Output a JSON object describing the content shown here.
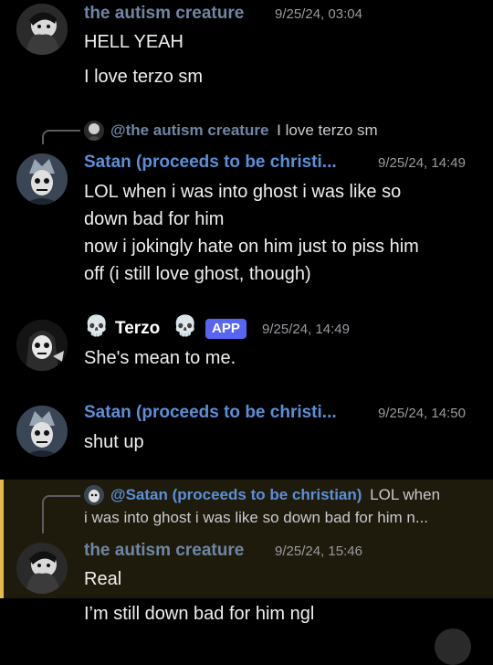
{
  "colors": {
    "background": "#000000",
    "username_autism": "#6e86a4",
    "username_satan": "#5b8fd8",
    "username_terzo": "#ffffff",
    "app_badge": "#5865f2",
    "highlight_bg": "#1f1b0c",
    "highlight_bar": "#e7b94a"
  },
  "messages": [
    {
      "username": "the autism creature",
      "timestamp": "9/25/24, 03:04",
      "lines": [
        "HELL YEAH",
        "I love terzo sm"
      ]
    },
    {
      "reply": {
        "mention": "@the autism creature",
        "text": "I love terzo sm"
      },
      "username": "Satan (proceeds to be christi...",
      "timestamp": "9/25/24, 14:49",
      "lines": [
        "LOL when i was into ghost i was like so",
        "down bad for him",
        "now i jokingly hate on him just to piss him",
        "off (i still love ghost, though)"
      ]
    },
    {
      "username": "Terzo",
      "prefix_emoji": "💀",
      "suffix_emoji": "💀",
      "badge": "APP",
      "timestamp": "9/25/24, 14:49",
      "lines": [
        "She's mean to me."
      ]
    },
    {
      "username": "Satan (proceeds to be christi...",
      "timestamp": "9/25/24, 14:50",
      "lines": [
        "shut up"
      ]
    },
    {
      "reply": {
        "mention": "@Satan (proceeds to be christian)",
        "text_line1": "LOL when",
        "text_line2": "i was into ghost i was like so down bad for him n..."
      },
      "username": "the autism creature",
      "timestamp": "9/25/24, 15:46",
      "lines": [
        "Real",
        "I’m still down bad for him ngl"
      ]
    }
  ]
}
